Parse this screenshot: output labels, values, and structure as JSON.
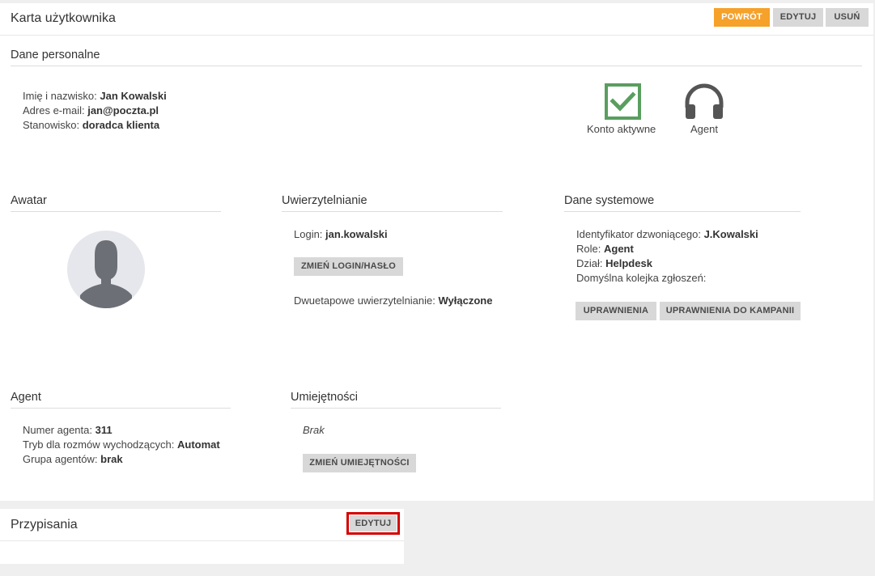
{
  "header": {
    "title": "Karta użytkownika",
    "back_label": "POWRÓT",
    "edit_label": "EDYTUJ",
    "delete_label": "USUŃ"
  },
  "personal": {
    "title": "Dane personalne",
    "name_label": "Imię i nazwisko:",
    "name_value": "Jan Kowalski",
    "email_label": "Adres e-mail:",
    "email_value": "jan@poczta.pl",
    "position_label": "Stanowisko:",
    "position_value": "doradca klienta",
    "account_active_label": "Konto aktywne",
    "agent_label": "Agent"
  },
  "avatar": {
    "title": "Awatar"
  },
  "auth": {
    "title": "Uwierzytelnianie",
    "login_label": "Login:",
    "login_value": "jan.kowalski",
    "change_login_label": "ZMIEŃ LOGIN/HASŁO",
    "twofactor_label": "Dwuetapowe uwierzytelnianie:",
    "twofactor_value": "Wyłączone"
  },
  "system": {
    "title": "Dane systemowe",
    "caller_id_label": "Identyfikator dzwoniącego:",
    "caller_id_value": "J.Kowalski",
    "role_label": "Role:",
    "role_value": "Agent",
    "department_label": "Dział:",
    "department_value": "Helpdesk",
    "queue_label": "Domyślna kolejka zgłoszeń:",
    "permissions_label": "UPRAWNIENIA",
    "campaign_permissions_label": "UPRAWNIENIA DO KAMPANII"
  },
  "agent": {
    "title": "Agent",
    "number_label": "Numer agenta:",
    "number_value": "311",
    "mode_label": "Tryb dla rozmów wychodzących:",
    "mode_value": "Automat",
    "group_label": "Grupa agentów:",
    "group_value": "brak"
  },
  "skills": {
    "title": "Umiejętności",
    "empty_text": "Brak",
    "change_skills_label": "ZMIEŃ UMIEJĘTNOŚCI"
  },
  "assignments": {
    "title": "Przypisania",
    "edit_label": "EDYTUJ"
  },
  "colors": {
    "accent": "#f5a12a",
    "check_green": "#5a9e5f",
    "highlight_red": "#d40000"
  },
  "icons": [
    "check-square-icon",
    "headset-icon",
    "user-silhouette-icon"
  ]
}
